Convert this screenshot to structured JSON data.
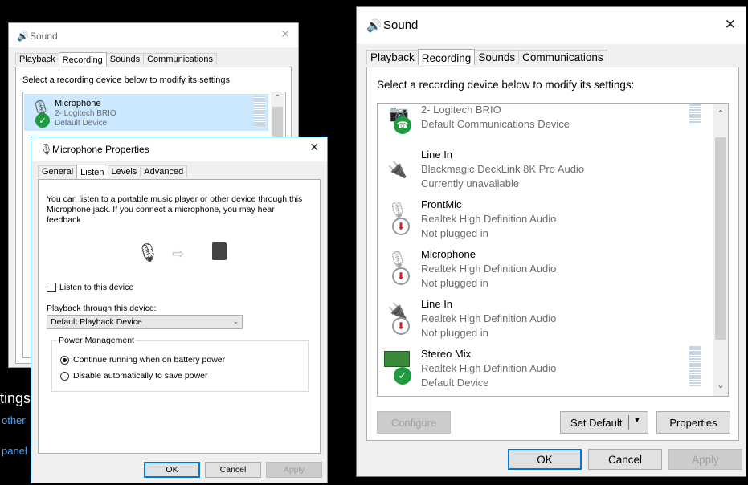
{
  "left": {
    "sound_window": {
      "title": "Sound",
      "tabs": [
        {
          "label": "Playback"
        },
        {
          "label": "Recording"
        },
        {
          "label": "Sounds"
        },
        {
          "label": "Communications"
        }
      ],
      "instruction": "Select a recording device below to modify its settings:",
      "device": {
        "name": "Microphone",
        "line1": "2- Logitech BRIO",
        "line2": "Default Device"
      }
    },
    "props_window": {
      "title": "Microphone Properties",
      "tabs": [
        {
          "label": "General"
        },
        {
          "label": "Listen"
        },
        {
          "label": "Levels"
        },
        {
          "label": "Advanced"
        }
      ],
      "description": "You can listen to a portable music player or other device through this Microphone jack.  If you connect a microphone, you may hear feedback.",
      "listen_checkbox_label": "Listen to this device",
      "playback_label": "Playback through this device:",
      "playback_value": "Default Playback Device",
      "power_group_label": "Power Management",
      "radio_continue": "Continue running when on battery power",
      "radio_disable": "Disable automatically to save power",
      "ok": "OK",
      "cancel": "Cancel",
      "apply": "Apply"
    },
    "bg_text": {
      "settings": "tings",
      "other": "other",
      "panel": "panel"
    }
  },
  "right": {
    "title": "Sound",
    "tabs": [
      {
        "label": "Playback"
      },
      {
        "label": "Recording"
      },
      {
        "label": "Sounds"
      },
      {
        "label": "Communications"
      }
    ],
    "instruction": "Select a recording device below to modify its settings:",
    "devices": [
      {
        "name": "2- Logitech BRIO",
        "line1": "Default Communications Device",
        "line2": ""
      },
      {
        "name": "Line In",
        "line1": "Blackmagic DeckLink 8K Pro Audio",
        "line2": "Currently unavailable"
      },
      {
        "name": "FrontMic",
        "line1": "Realtek High Definition Audio",
        "line2": "Not plugged in"
      },
      {
        "name": "Microphone",
        "line1": "Realtek High Definition Audio",
        "line2": "Not plugged in"
      },
      {
        "name": "Line In",
        "line1": "Realtek High Definition Audio",
        "line2": "Not plugged in"
      },
      {
        "name": "Stereo Mix",
        "line1": "Realtek High Definition Audio",
        "line2": "Default Device"
      }
    ],
    "configure": "Configure",
    "set_default": "Set Default",
    "properties": "Properties",
    "ok": "OK",
    "cancel": "Cancel",
    "apply": "Apply"
  },
  "colors": {
    "accent": "#0078d7",
    "green": "#1f9b3f",
    "red": "#d41f1f"
  },
  "icons": [
    "speaker-icon",
    "microphone-icon",
    "line-in-icon",
    "board-icon",
    "check-icon",
    "phone-icon",
    "down-arrow-icon",
    "close-icon"
  ]
}
